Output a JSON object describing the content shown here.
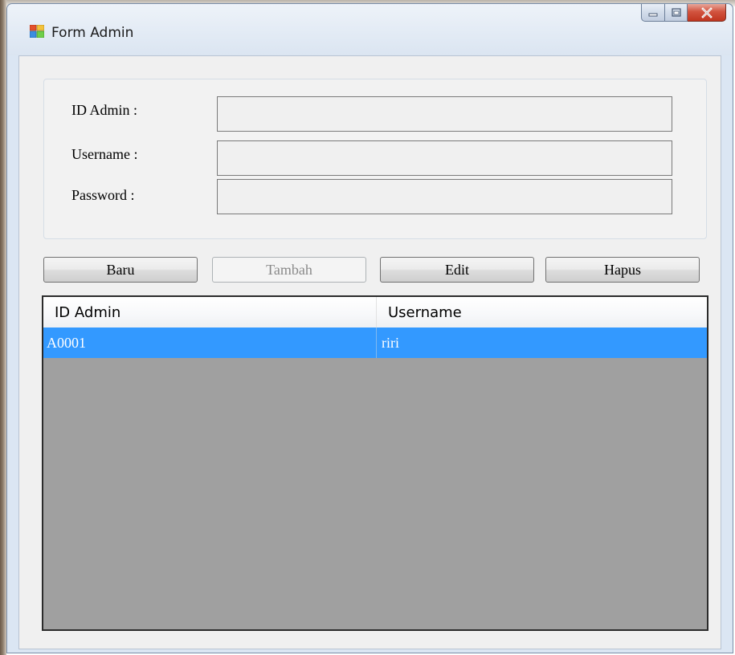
{
  "window": {
    "title": "Form Admin"
  },
  "form": {
    "id_label": "ID Admin :",
    "id_value": "",
    "username_label": "Username :",
    "username_value": "",
    "password_label": "Password :",
    "password_value": ""
  },
  "buttons": {
    "baru": "Baru",
    "tambah": "Tambah",
    "edit": "Edit",
    "hapus": "Hapus"
  },
  "grid": {
    "columns": [
      "ID Admin",
      "Username"
    ],
    "rows": [
      [
        "A0001",
        "riri"
      ]
    ],
    "selected_row_color": "#3399ff"
  },
  "icons": {
    "app": "form-app-icon",
    "minimize": "minimize-icon",
    "maximize": "maximize-icon",
    "close": "close-icon"
  }
}
